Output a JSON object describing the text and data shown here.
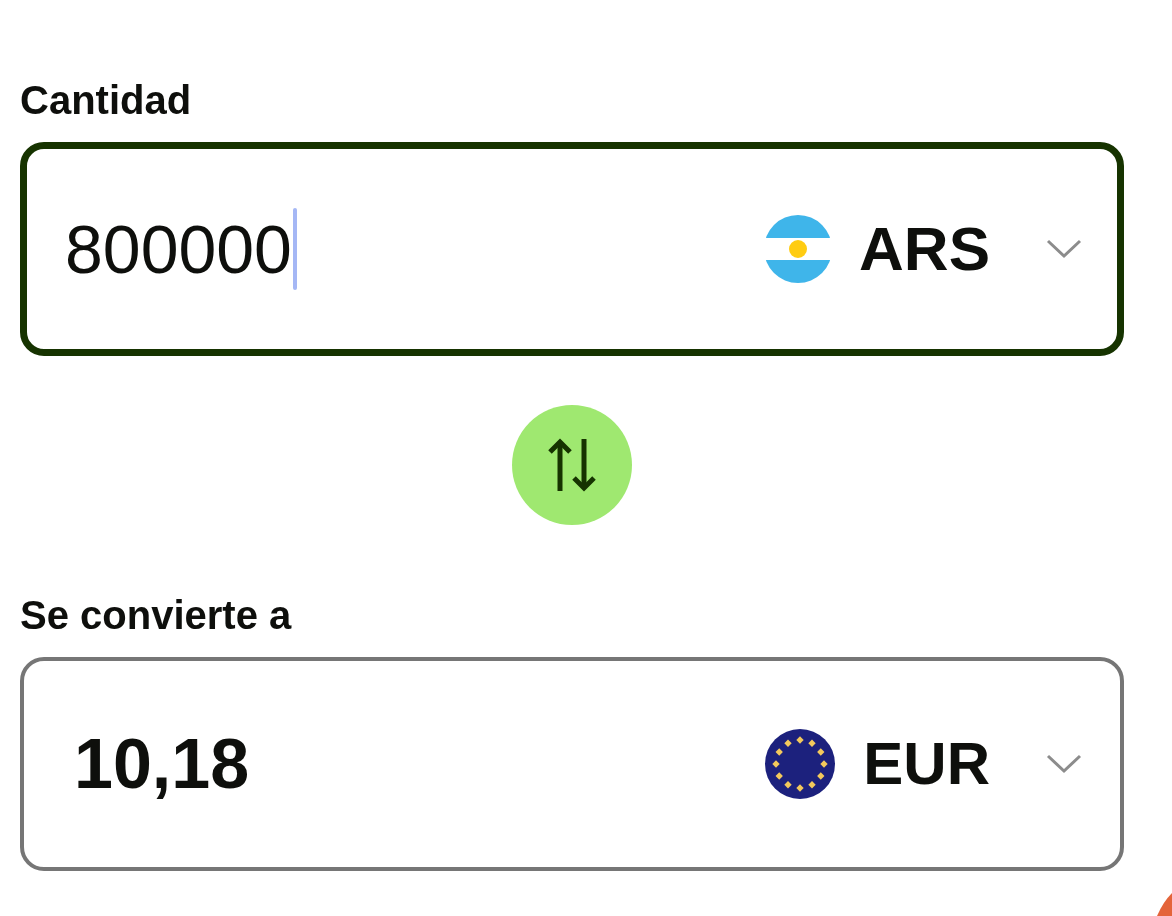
{
  "amount": {
    "label": "Cantidad",
    "value": "800000",
    "focused": true,
    "currency": {
      "code": "ARS"
    }
  },
  "converted": {
    "label": "Se convierte a",
    "value": "10,18",
    "focused": false,
    "currency": {
      "code": "EUR"
    }
  }
}
